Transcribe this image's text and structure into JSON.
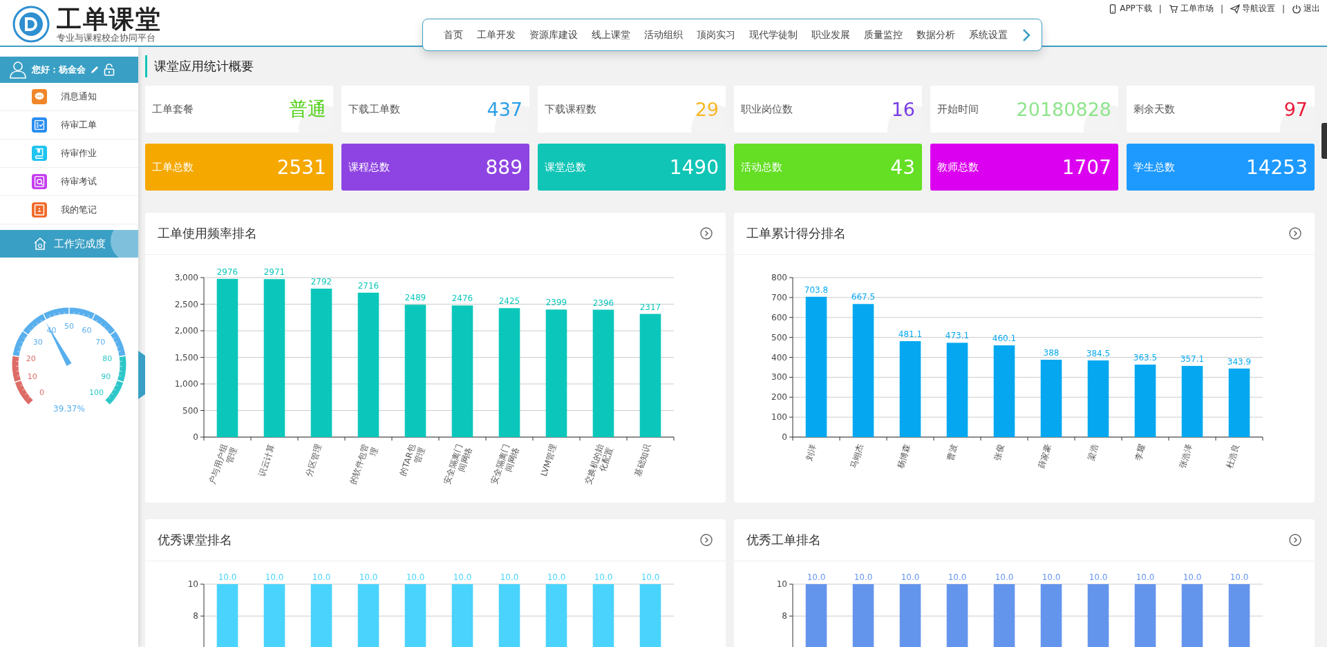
{
  "header": {
    "logo_title": "工单课堂",
    "logo_subtitle": "专业与课程校企协同平台",
    "top_links": [
      {
        "kind": "phone",
        "label": "APP下载"
      },
      {
        "kind": "cart",
        "label": "工单市场"
      },
      {
        "kind": "send",
        "label": "导航设置"
      },
      {
        "kind": "power",
        "label": "退出"
      }
    ],
    "link_separators": [
      "|",
      "|",
      "|"
    ],
    "nav": [
      "首页",
      "工单开发",
      "资源库建设",
      "线上课堂",
      "活动组织",
      "顶岗实习",
      "现代学徒制",
      "职业发展",
      "质量监控",
      "数据分析",
      "系统设置"
    ]
  },
  "sidebar": {
    "greeting": "您好：杨金会",
    "menu": [
      {
        "label": "消息通知",
        "kind": "chat",
        "color": "#f0862a"
      },
      {
        "label": "待审工单",
        "kind": "list",
        "color": "#2a8ef0"
      },
      {
        "label": "待审作业",
        "kind": "book",
        "color": "#1fc3f0"
      },
      {
        "label": "待审考试",
        "kind": "search",
        "color": "#c53ef0"
      },
      {
        "label": "我的笔记",
        "kind": "note",
        "color": "#f06a2a"
      }
    ],
    "progress": {
      "title": "工作完成度",
      "level": 0.3937,
      "reading": "39.37%",
      "scale": [
        "0",
        "10",
        "20",
        "30",
        "40",
        "50",
        "60",
        "70",
        "80",
        "90",
        "100"
      ]
    }
  },
  "main": {
    "title": "课堂应用统计概要",
    "summary_cards": [
      {
        "label": "工单套餐",
        "value": "普通",
        "color": "#52d11a"
      },
      {
        "label": "下载工单数",
        "value": "437",
        "color": "#2d9fe6"
      },
      {
        "label": "下载课程数",
        "value": "29",
        "color": "#f7b824"
      },
      {
        "label": "职业岗位数",
        "value": "16",
        "color": "#7a3ce6"
      },
      {
        "label": "开始时间",
        "value": "20180828",
        "color": "#8fe48c"
      },
      {
        "label": "剩余天数",
        "value": "97",
        "color": "#ea1b3a"
      }
    ],
    "total_cards": [
      {
        "label": "工单总数",
        "value": "2531",
        "color": "#f5a800"
      },
      {
        "label": "课程总数",
        "value": "889",
        "color": "#8e44e2"
      },
      {
        "label": "课堂总数",
        "value": "1490",
        "color": "#10c5b6"
      },
      {
        "label": "活动总数",
        "value": "43",
        "color": "#64df24"
      },
      {
        "label": "教师总数",
        "value": "1707",
        "color": "#dc00f0"
      },
      {
        "label": "学生总数",
        "value": "14253",
        "color": "#1e9aff"
      }
    ],
    "panels": [
      {
        "chart_data": {
          "type": "bar",
          "title": "工单使用频率排名",
          "categories": [
            "户与用户组管理",
            "识云计算",
            "分区管理",
            "的软件包管理",
            "的TAR包管理",
            "安全隔离门间网络",
            "安全隔离门间网络",
            "LVM管理",
            "交换机的始化配置",
            "基础知识"
          ],
          "series": [
            {
              "color": "#0bc7bb",
              "values": [
                2976,
                2971,
                2792,
                2716,
                2489,
                2476,
                2425,
                2399,
                2396,
                2317
              ]
            }
          ],
          "ylim": [
            0,
            3000
          ],
          "grid": true,
          "yticks": [
            {
              "value": 0,
              "label": "0"
            },
            500,
            {
              "value": 1000,
              "label": "1,000"
            },
            {
              "value": 1500,
              "label": "1,500"
            },
            {
              "value": 2000,
              "label": "2,000"
            },
            {
              "value": 2500,
              "label": "2,500"
            },
            {
              "value": 3000,
              "label": "3,000"
            }
          ],
          "data_labels": true
        }
      },
      {
        "chart_data": {
          "type": "bar",
          "title": "工单累计得分排名",
          "categories": [
            "刘洋",
            "马翊杰",
            "杨博森",
            "曹波",
            "张俊",
            "薛家豪",
            "梁浩",
            "李耀",
            "张浩泽",
            "杜浩良"
          ],
          "series": [
            {
              "color": "#05a8f0",
              "values": [
                703.8,
                667.5,
                481.1,
                473.1,
                460.1,
                388,
                384.5,
                363.5,
                357.1,
                343.9
              ]
            }
          ],
          "ylim": [
            0,
            800
          ],
          "grid": true,
          "yticks": [
            {
              "value": 0,
              "label": "0"
            },
            {
              "value": 100,
              "label": "100"
            },
            200,
            300,
            400,
            500,
            600,
            700,
            800
          ],
          "data_labels": true
        }
      },
      {
        "chart_data": {
          "type": "bar",
          "title": "优秀课堂排名",
          "series": [
            {
              "color": "#4ad3fc",
              "values": [
                10,
                10,
                10,
                10,
                10,
                10,
                10,
                10,
                10,
                10
              ]
            }
          ],
          "ylim": [
            0,
            10
          ],
          "grid": true,
          "yticks": [
            8,
            {
              "value": 10,
              "label": "10"
            }
          ],
          "value_labels": [
            "10.0",
            "10.0",
            "10.0",
            "10.0",
            "10.0",
            "10.0",
            "10.0",
            "10.0",
            "10.0",
            "10.0"
          ]
        }
      },
      {
        "chart_data": {
          "type": "bar",
          "title": "优秀工单排名",
          "series": [
            {
              "color": "#6495ed",
              "values": [
                10,
                10,
                10,
                10,
                10,
                10,
                10,
                10,
                10,
                10
              ]
            }
          ],
          "ylim": [
            0,
            10
          ],
          "grid": true,
          "yticks": [
            8,
            {
              "value": 10,
              "label": "10"
            }
          ],
          "value_labels": [
            "10.0",
            "10.0",
            "10.0",
            "10.0",
            "10.0",
            "10.0",
            "10.0",
            "10.0",
            "10.0",
            "10.0"
          ]
        }
      }
    ]
  }
}
